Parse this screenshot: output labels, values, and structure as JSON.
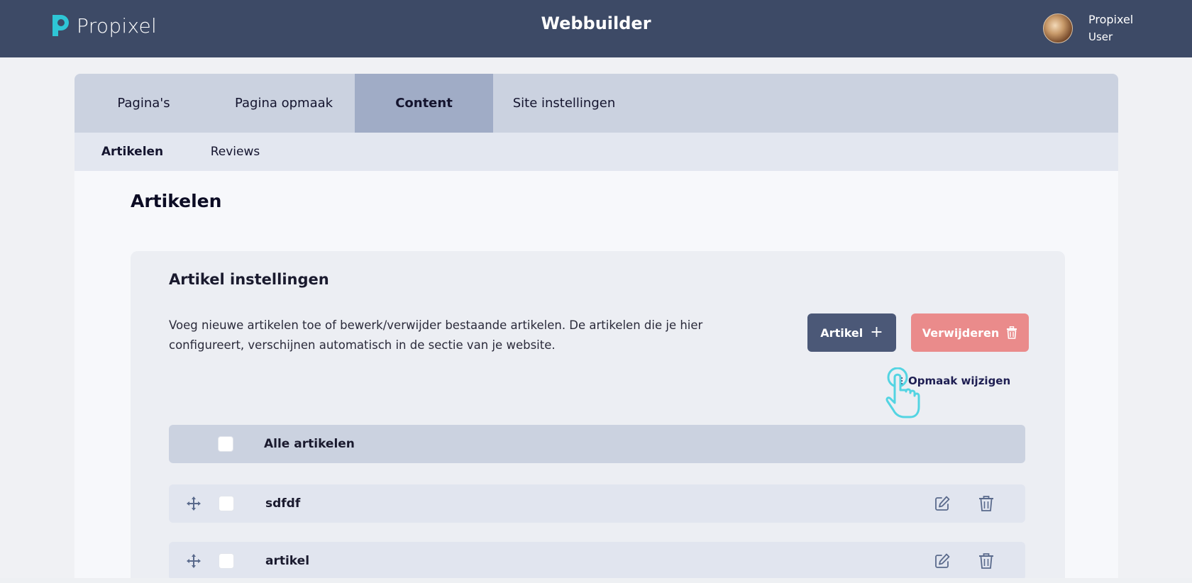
{
  "header": {
    "brand": "Propixel",
    "app_title": "Webbuilder",
    "user": {
      "name": "Propixel",
      "role": "User"
    }
  },
  "tabs": [
    {
      "label": "Pagina's",
      "active": false
    },
    {
      "label": "Pagina opmaak",
      "active": false
    },
    {
      "label": "Content",
      "active": true
    },
    {
      "label": "Site instellingen",
      "active": false
    }
  ],
  "subtabs": [
    {
      "label": "Artikelen",
      "active": true
    },
    {
      "label": "Reviews",
      "active": false
    }
  ],
  "page": {
    "title": "Artikelen",
    "panel": {
      "title": "Artikel instellingen",
      "description": "Voeg nieuwe artikelen toe of bewerk/verwijder bestaande artikelen. De artikelen die je hier configureert, verschijnen automatisch in de sectie van je website.",
      "add_button": "Artikel",
      "delete_button": "Verwijderen",
      "opmaak_link": "Opmaak wijzigen",
      "list_header": "Alle artikelen",
      "items": [
        {
          "title": "sdfdf"
        },
        {
          "title": "artikel"
        }
      ]
    }
  },
  "colors": {
    "topbar": "#3d4a66",
    "brand_accent": "#2ec6d6",
    "primary_button": "#4b5877",
    "danger_button": "#ea8b8b",
    "tab_active": "#a0acc6"
  },
  "icons": {
    "add": "plus-icon",
    "delete": "trash-icon",
    "opmaak": "sliders-icon",
    "row_move": "move-icon",
    "row_edit": "edit-icon",
    "row_delete": "trash-icon"
  }
}
